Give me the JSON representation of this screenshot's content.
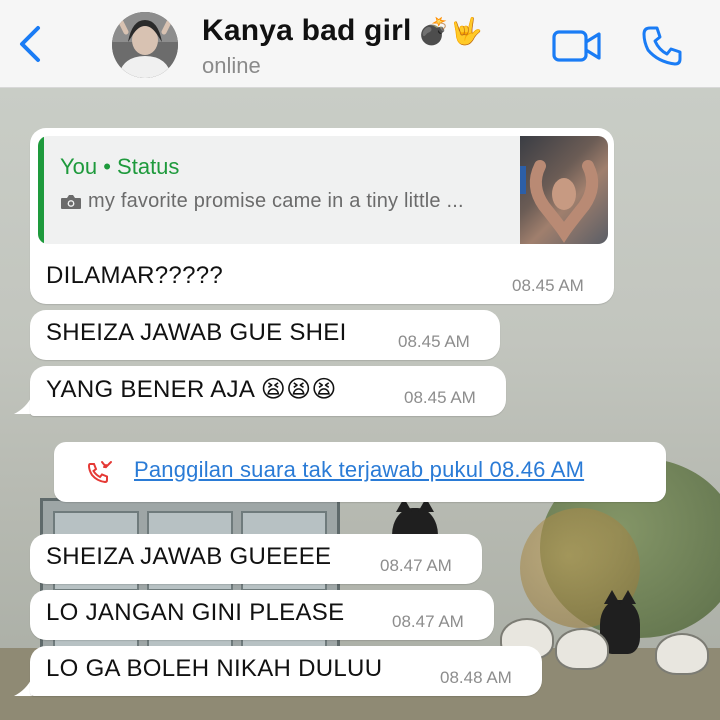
{
  "header": {
    "back_label": "back",
    "contact_name": "Kanya bad girl",
    "contact_emoji": "💣🤟",
    "status": "online",
    "accent_color": "#1a7cf5"
  },
  "quoted_status": {
    "title": "You • Status",
    "text": "my favorite promise came in a tiny little ...",
    "accent_color": "#1e9a3c"
  },
  "messages": [
    {
      "text": "DILAMAR?????",
      "time": "08.45 AM"
    },
    {
      "text": "SHEIZA JAWAB GUE SHEI",
      "time": "08.45 AM"
    },
    {
      "text": "YANG BENER AJA 😫😫😫",
      "time": "08.45 AM"
    },
    {
      "text": "SHEIZA JAWAB GUEEEE",
      "time": "08.47 AM"
    },
    {
      "text": "LO JANGAN GINI PLEASE",
      "time": "08.47 AM"
    },
    {
      "text": "LO GA BOLEH NIKAH DULUU",
      "time": "08.48 AM"
    }
  ],
  "missed_call": {
    "text": "Panggilan suara tak terjawab pukul 08.46 AM",
    "color": "#2a7bd6",
    "icon_color": "#e53935"
  }
}
